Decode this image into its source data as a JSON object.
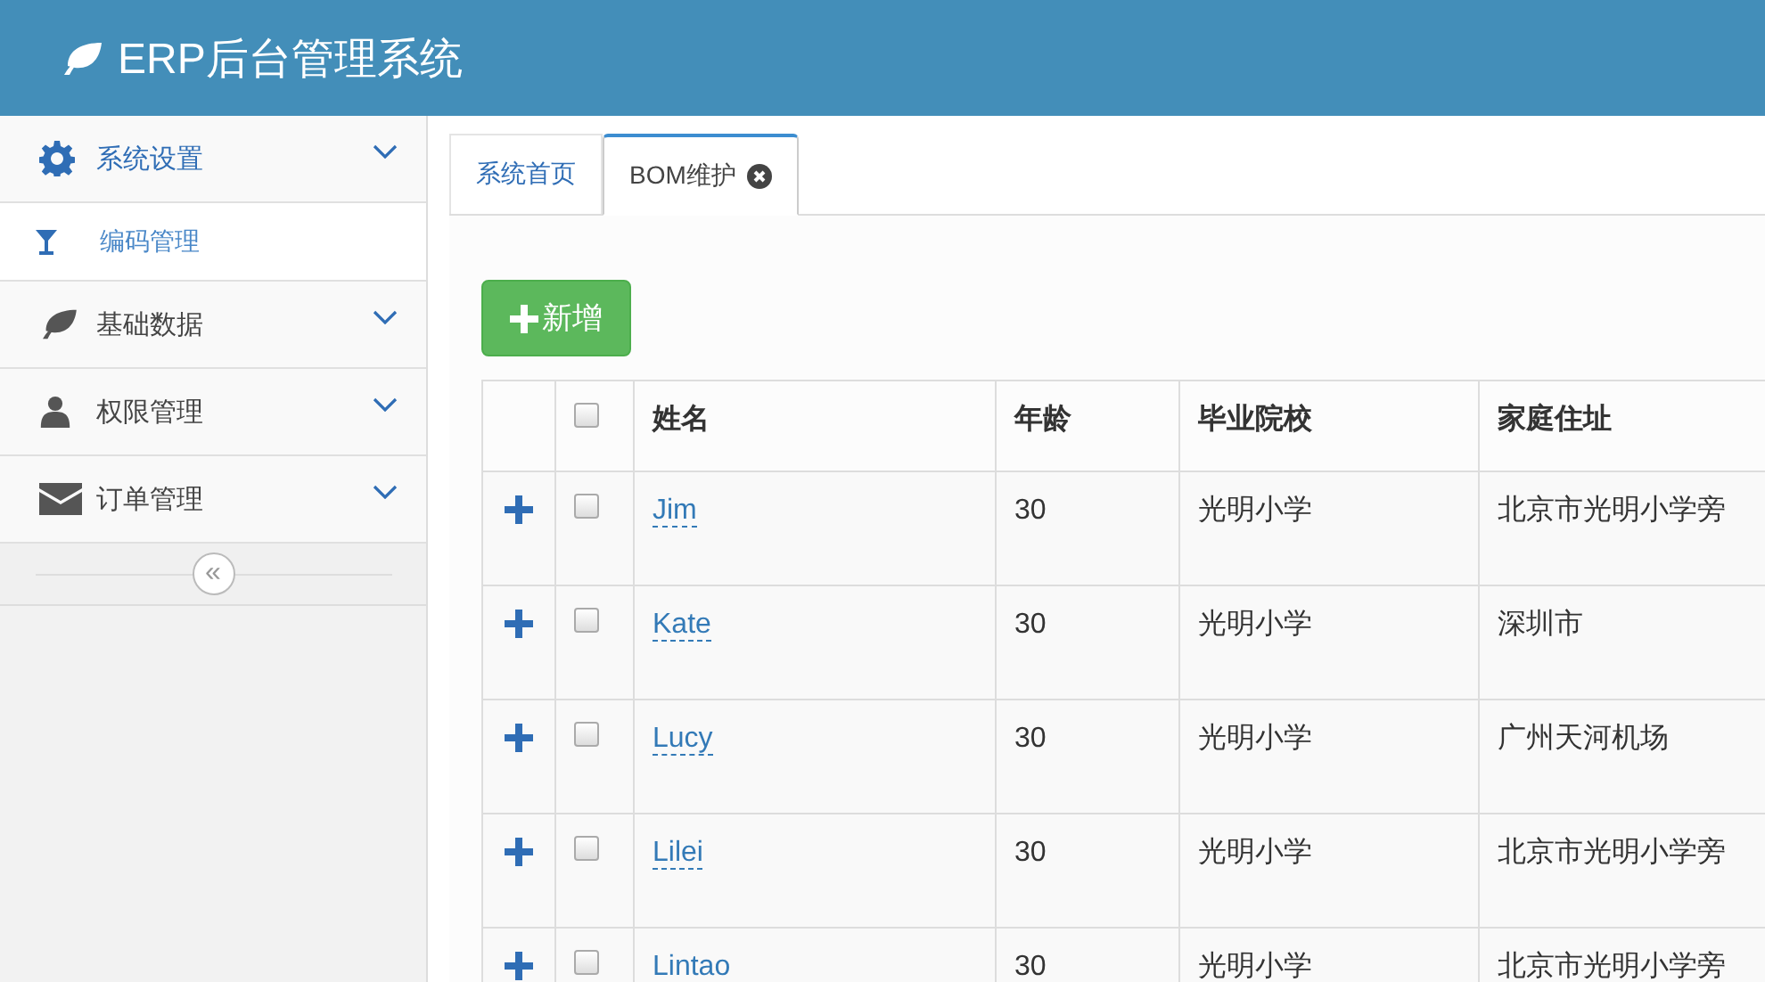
{
  "header": {
    "title": "ERP后台管理系统"
  },
  "sidebar": {
    "groups": [
      {
        "label": "系统设置",
        "expanded": true,
        "children": [
          {
            "label": "编码管理",
            "selected": true
          }
        ]
      },
      {
        "label": "基础数据",
        "expanded": false
      },
      {
        "label": "权限管理",
        "expanded": false
      },
      {
        "label": "订单管理",
        "expanded": false
      }
    ],
    "collapse_label": "«"
  },
  "tabs": [
    {
      "label": "系统首页",
      "selected": false,
      "closable": false
    },
    {
      "label": "BOM维护",
      "selected": true,
      "closable": true
    }
  ],
  "add_button": {
    "label": "新增"
  },
  "table": {
    "columns": [
      "姓名",
      "年龄",
      "毕业院校",
      "家庭住址"
    ],
    "header_checked": false,
    "rows": [
      {
        "checked": false,
        "cells": [
          "Jim",
          "30",
          "光明小学",
          "北京市光明小学旁"
        ]
      },
      {
        "checked": false,
        "cells": [
          "Kate",
          "30",
          "光明小学",
          "深圳市"
        ]
      },
      {
        "checked": false,
        "cells": [
          "Lucy",
          "30",
          "光明小学",
          "广州天河机场"
        ]
      },
      {
        "checked": false,
        "cells": [
          "Lilei",
          "30",
          "光明小学",
          "北京市光明小学旁"
        ]
      },
      {
        "checked": false,
        "cells": [
          "Lintao",
          "30",
          "光明小学",
          "北京市光明小学旁"
        ]
      }
    ]
  }
}
